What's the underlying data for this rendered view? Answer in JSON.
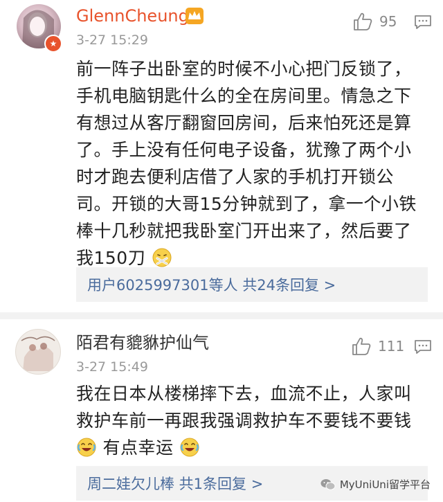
{
  "comments": [
    {
      "username": "GlennCheung",
      "time": "3-27 15:29",
      "likes": "95",
      "lines": [
        "前一阵子出卧室的时候不小心把门反锁了，",
        "手机电脑钥匙什么的全在房间里。情急之下",
        "有想过从客厅翻窗回房间，后来怕死还是算",
        "了。手上没有任何电子设备，犹豫了两个小",
        "时才跑去便利店借了人家的手机打开锁公",
        "司。开锁的大哥15分钟就到了，拿一个小铁",
        "棒十几秒就把我卧室门开出来了，然后要了",
        "我150刀"
      ],
      "replies_summary": "用户6025997301等人  共24条回复 >"
    },
    {
      "username": "陌君有貔貅护仙气",
      "time": "3-27 15:49",
      "likes": "111",
      "lines": [
        "我在日本从楼梯摔下去，血流不止，人家叫",
        "救护车前一再跟我强调救护车不要钱不要钱",
        "有点幸运"
      ],
      "replies_summary": "周二娃欠儿棒  共1条回复 >"
    }
  ],
  "watermark": "MyUniUni留学平台",
  "colors": {
    "link": "#4a6b9c",
    "meta": "#999999",
    "badge": "#e8532c",
    "vip": "#f5a623"
  }
}
